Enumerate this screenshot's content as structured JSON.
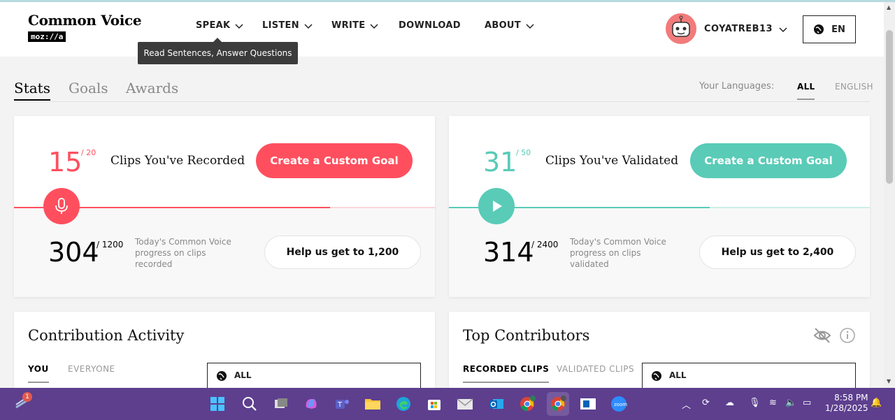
{
  "header": {
    "logo_title": "Common Voice",
    "logo_sub": "moz://a",
    "nav": [
      {
        "label": "SPEAK",
        "has_dropdown": true
      },
      {
        "label": "LISTEN",
        "has_dropdown": true
      },
      {
        "label": "WRITE",
        "has_dropdown": true
      },
      {
        "label": "DOWNLOAD",
        "has_dropdown": false
      },
      {
        "label": "ABOUT",
        "has_dropdown": true
      }
    ],
    "tooltip": "Read Sentences, Answer Questions",
    "username": "COYATREB13",
    "language_button": "EN"
  },
  "tabs": {
    "items": [
      "Stats",
      "Goals",
      "Awards"
    ],
    "active": "Stats",
    "your_languages_label": "Your Languages:",
    "language_tabs": [
      "ALL",
      "ENGLISH"
    ],
    "active_language_tab": "ALL"
  },
  "recorded_card": {
    "count": "15",
    "goal": "/ 20",
    "progress_fraction": 0.75,
    "label": "Clips You've Recorded",
    "button": "Create a Custom Goal",
    "total": "304",
    "total_goal": "/ 1200",
    "desc": "Today's Common Voice progress on clips recorded",
    "help_button": "Help us get to 1,200",
    "accent": "#ff4f5e"
  },
  "validated_card": {
    "count": "31",
    "goal": "/ 50",
    "progress_fraction": 0.62,
    "label": "Clips You've Validated",
    "button": "Create a Custom Goal",
    "total": "314",
    "total_goal": "/ 2400",
    "desc": "Today's Common Voice progress on clips validated",
    "help_button": "Help us get to 2,400",
    "accent": "#59cbb7"
  },
  "contribution": {
    "title": "Contribution Activity",
    "tabs": [
      "YOU",
      "EVERYONE"
    ],
    "active_tab": "YOU",
    "select_value": "ALL"
  },
  "top_contributors": {
    "title": "Top Contributors",
    "tabs": [
      "RECORDED CLIPS",
      "VALIDATED CLIPS"
    ],
    "active_tab": "RECORDED CLIPS",
    "select_value": "ALL"
  },
  "taskbar": {
    "notification_count": "1",
    "time": "8:58 PM",
    "date": "1/28/2025",
    "apps": [
      "windows-start",
      "search",
      "task-view",
      "copilot",
      "teams",
      "file-explorer",
      "edge",
      "microsoft-store",
      "mail",
      "outlook",
      "chrome",
      "chrome",
      "whiteboard",
      "zoom"
    ]
  }
}
